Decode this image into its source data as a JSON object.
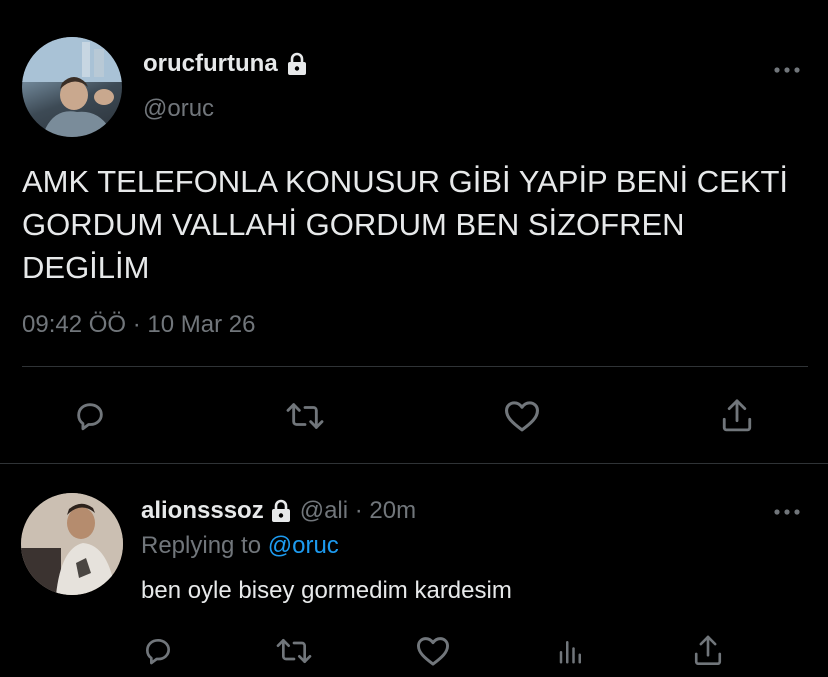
{
  "tweet": {
    "display_name": "orucfurtuna",
    "handle": "@oruc",
    "text": "AMK TELEFONLA KONUSUR GİBİ YAPİP BENİ CEKTİ GORDUM VALLAHİ GORDUM BEN SİZOFREN DEGİLİM",
    "timestamp": "09:42 ÖÖ · 10 Mar 26"
  },
  "reply": {
    "display_name": "alionsssoz",
    "handle_time": "@ali · 20m",
    "replying_prefix": "Replying to",
    "replying_mention": "@oruc",
    "text": "ben oyle bisey gormedim kardesim"
  },
  "icons": {
    "reply": "reply-icon",
    "retweet": "retweet-icon",
    "like": "heart-icon",
    "share": "share-icon",
    "analytics": "analytics-icon",
    "more": "more-icon",
    "lock": "lock-icon"
  },
  "colors": {
    "background": "#000000",
    "text": "#e7e9ea",
    "muted": "#71767b",
    "link": "#1d9bf0",
    "divider": "#2f3336"
  }
}
